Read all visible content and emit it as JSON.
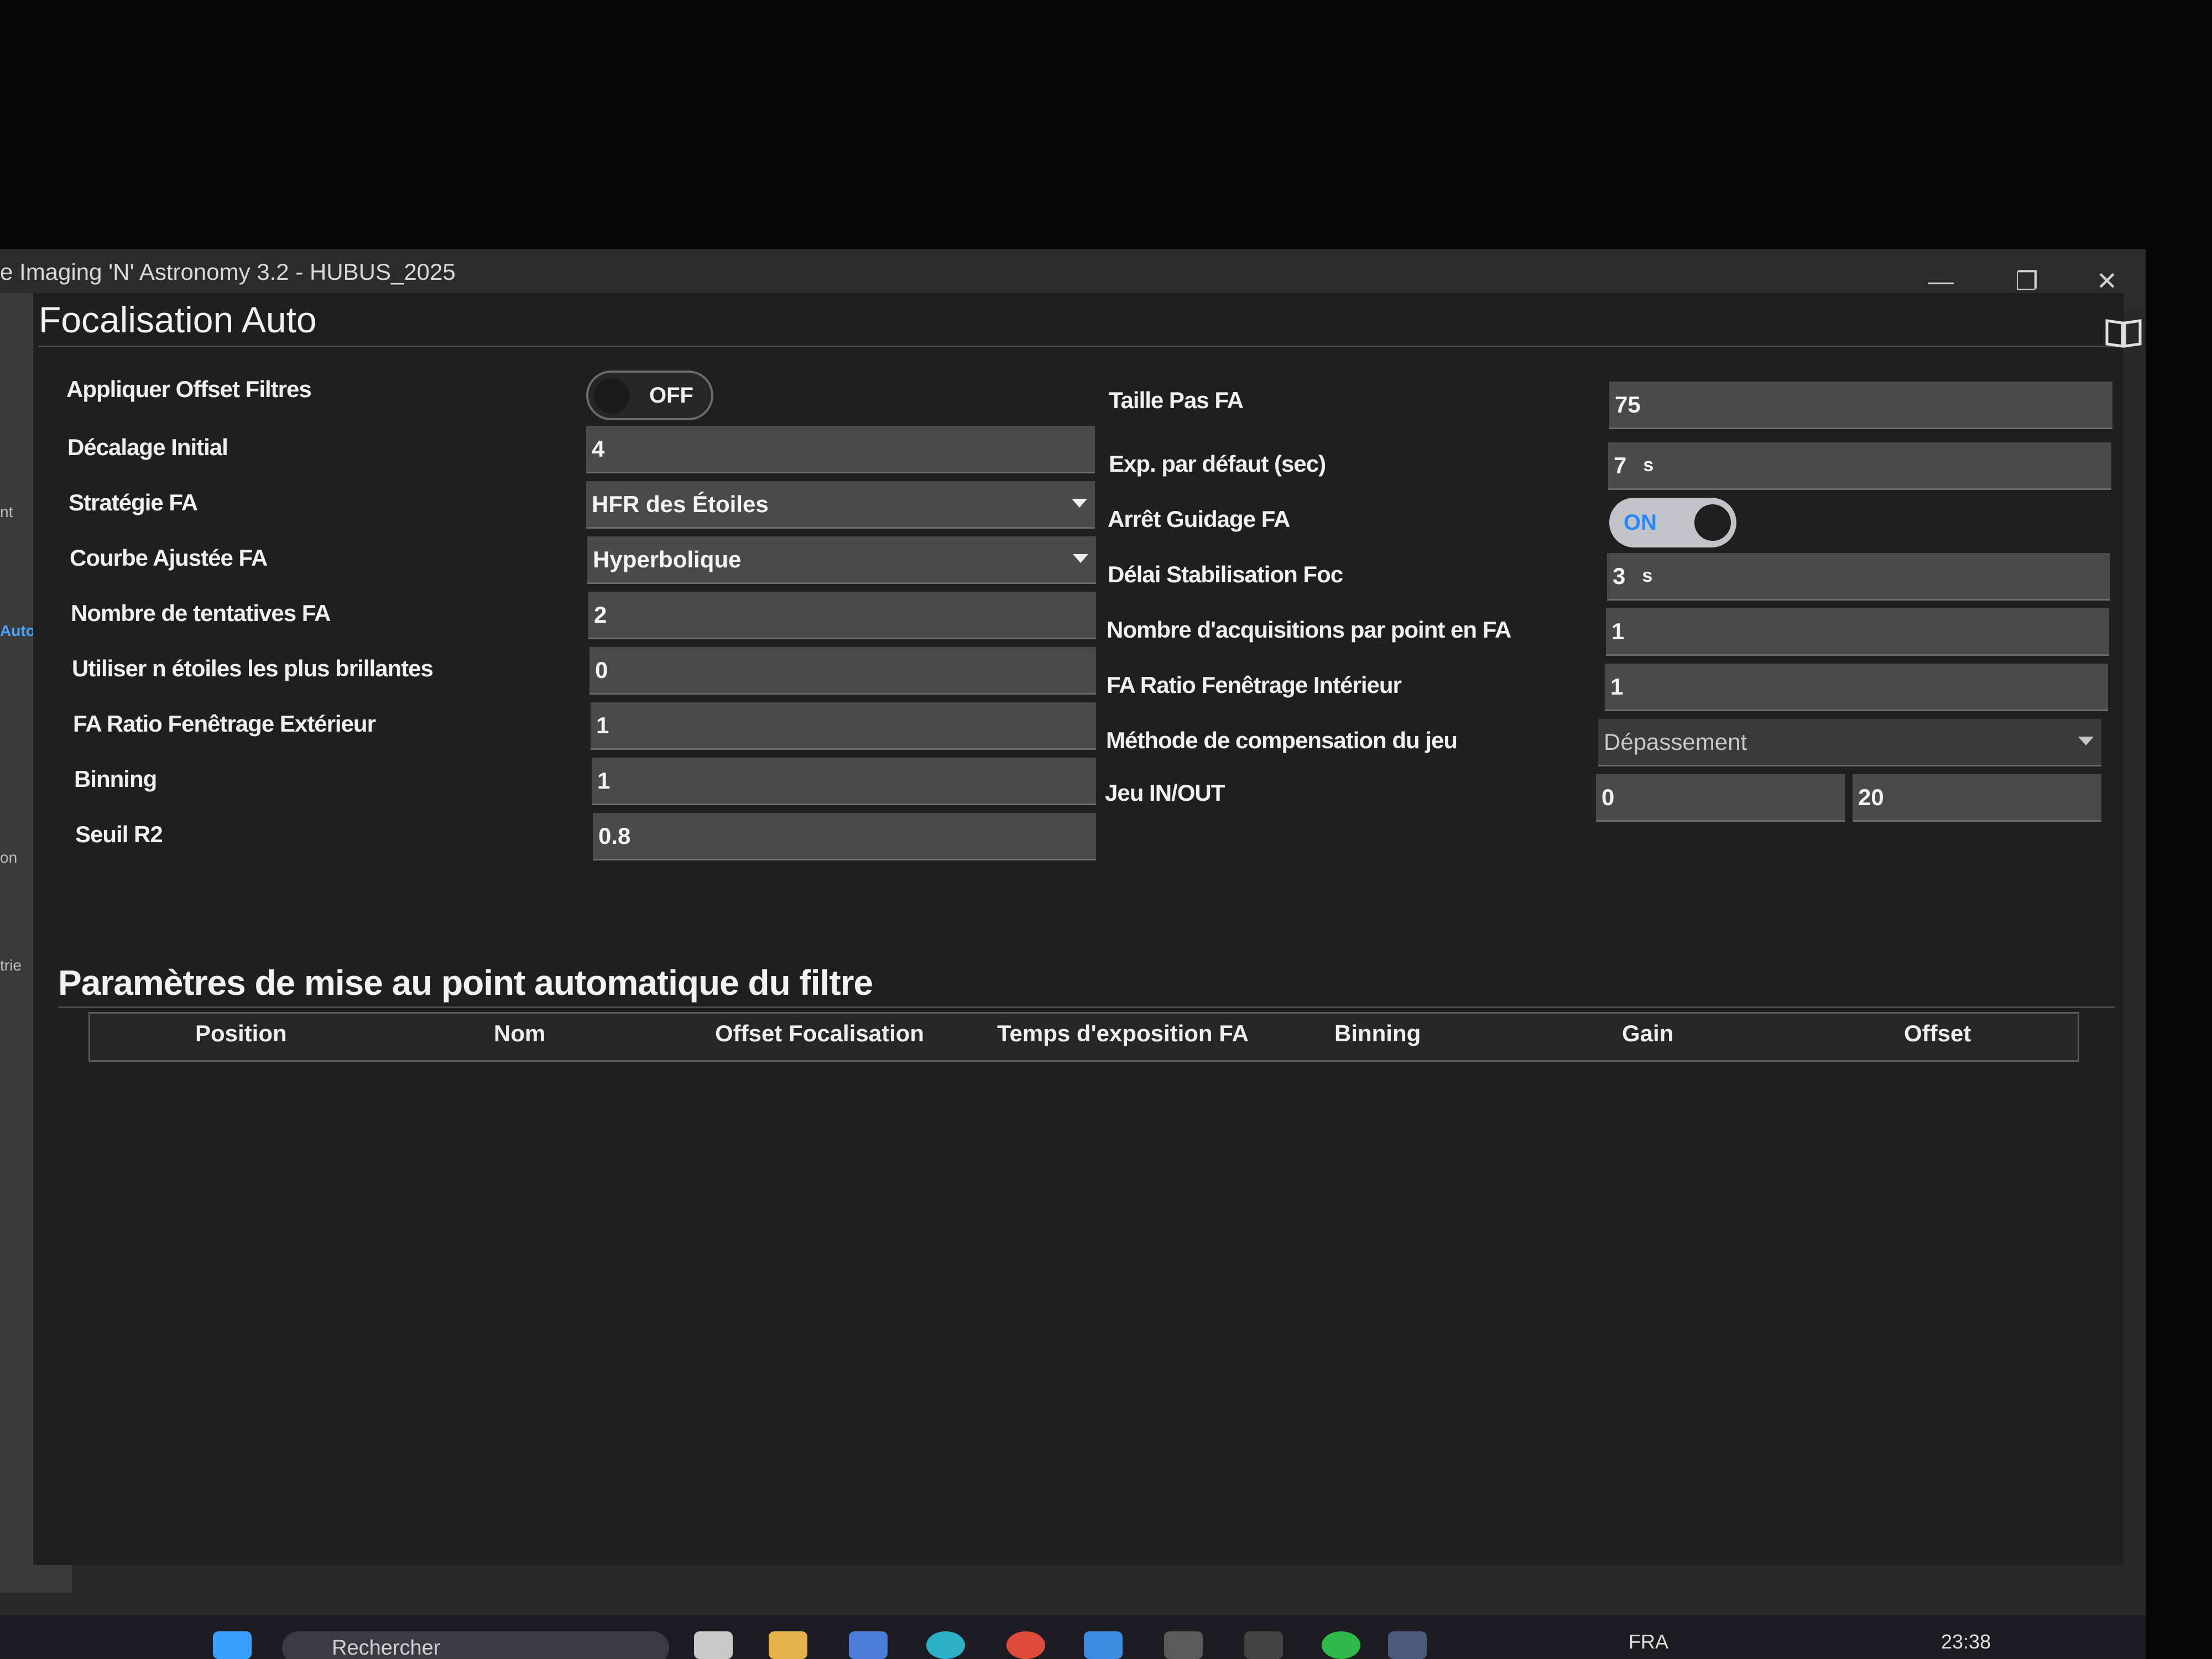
{
  "window": {
    "title": "e Imaging 'N' Astronomy 3.2  -  HUBUS_2025",
    "minimize": "—",
    "maximize": "❐",
    "close": "✕"
  },
  "sidebar": {
    "items": [
      "nt",
      "Auto",
      "on",
      "trie"
    ]
  },
  "page": {
    "title": "Focalisation Auto"
  },
  "left": {
    "appliquer_offset_label": "Appliquer Offset Filtres",
    "appliquer_offset_state": "OFF",
    "decalage_label": "Décalage Initial",
    "decalage_value": "4",
    "strategie_label": "Stratégie FA",
    "strategie_value": "HFR des Étoiles",
    "courbe_label": "Courbe Ajustée FA",
    "courbe_value": "Hyperbolique",
    "tentatives_label": "Nombre de tentatives FA",
    "tentatives_value": "2",
    "etoiles_label": "Utiliser n étoiles les plus brillantes",
    "etoiles_value": "0",
    "ratio_ext_label": "FA Ratio Fenêtrage Extérieur",
    "ratio_ext_value": "1",
    "binning_label": "Binning",
    "binning_value": "1",
    "seuil_label": "Seuil R2",
    "seuil_value": "0.8"
  },
  "right": {
    "taille_label": "Taille Pas FA",
    "taille_value": "75",
    "exp_label": "Exp. par défaut (sec)",
    "exp_value": "7",
    "exp_unit": "s",
    "arret_label": "Arrêt Guidage FA",
    "arret_state": "ON",
    "delai_label": "Délai Stabilisation Foc",
    "delai_value": "3",
    "delai_unit": "s",
    "acq_label": "Nombre d'acquisitions par point en FA",
    "acq_value": "1",
    "ratio_int_label": "FA Ratio Fenêtrage Intérieur",
    "ratio_int_value": "1",
    "methode_label": "Méthode de compensation du jeu",
    "methode_value": "Dépassement",
    "jeu_label": "Jeu IN/OUT",
    "jeu_in": "0",
    "jeu_out": "20"
  },
  "filters": {
    "title": "Paramètres de mise au point automatique du filtre",
    "columns": [
      "Position",
      "Nom",
      "Offset Focalisation",
      "Temps d'exposition FA",
      "Binning",
      "Gain",
      "Offset"
    ]
  },
  "taskbar": {
    "search_placeholder": "Rechercher",
    "lang": "FRA",
    "time": "23:38"
  }
}
